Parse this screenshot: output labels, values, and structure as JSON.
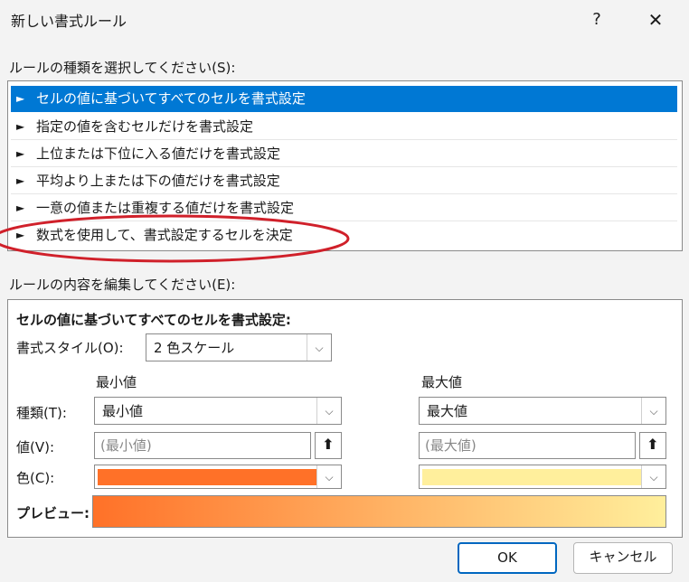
{
  "window": {
    "title": "新しい書式ルール",
    "help": "?",
    "close": "✕"
  },
  "rule_type": {
    "label": "ルールの種類を選択してください(S):",
    "items": [
      {
        "label": "セルの値に基づいてすべてのセルを書式設定",
        "selected": true
      },
      {
        "label": "指定の値を含むセルだけを書式設定",
        "selected": false
      },
      {
        "label": "上位または下位に入る値だけを書式設定",
        "selected": false
      },
      {
        "label": "平均より上または下の値だけを書式設定",
        "selected": false
      },
      {
        "label": "一意の値または重複する値だけを書式設定",
        "selected": false
      },
      {
        "label": "数式を使用して、書式設定するセルを決定",
        "selected": false
      }
    ],
    "arrow": "►",
    "highlight_color": "#d0202a"
  },
  "rule_edit": {
    "label": "ルールの内容を編集してください(E):",
    "heading": "セルの値に基づいてすべてのセルを書式設定:",
    "style_label": "書式スタイル(O):",
    "style_value": "2 色スケール",
    "min_header": "最小値",
    "max_header": "最大値",
    "type_label": "種類(T):",
    "value_label": "値(V):",
    "color_label": "色(C):",
    "min_type": "最小値",
    "max_type": "最大値",
    "min_value_placeholder": "(最小値)",
    "max_value_placeholder": "(最大値)",
    "min_color": "#ff7128",
    "max_color": "#ffef9c",
    "preview_label": "プレビュー:"
  },
  "buttons": {
    "ok": "OK",
    "cancel": "キャンセル"
  },
  "icons": {
    "dropdown": "chevron-down-icon",
    "ref": "range-select-icon"
  }
}
